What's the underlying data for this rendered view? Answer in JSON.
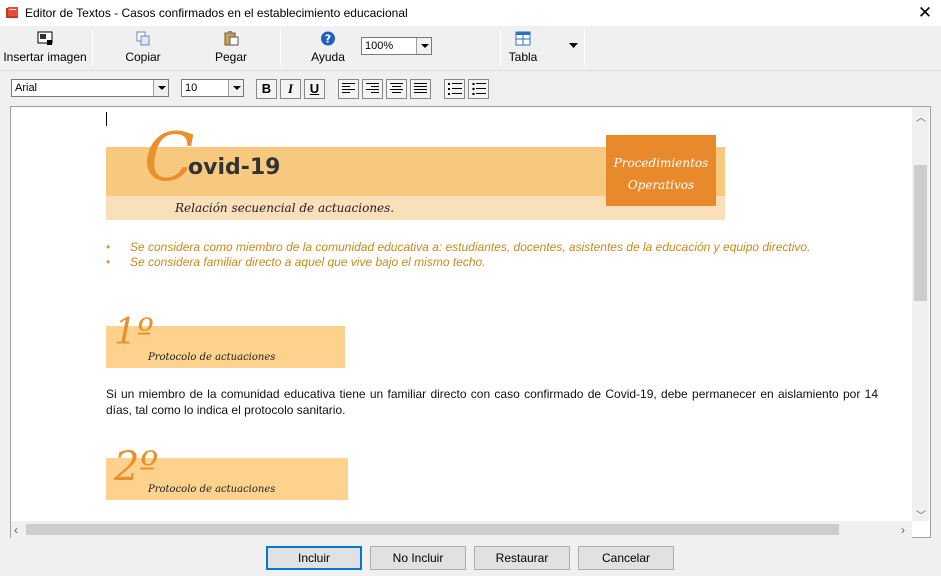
{
  "window": {
    "title": "Editor de Textos - Casos confirmados en el establecimiento educacional"
  },
  "toolbar": {
    "insert_image": "Insertar imagen",
    "copy": "Copiar",
    "paste": "Pegar",
    "help": "Ayuda",
    "zoom": "100%",
    "table": "Tabla"
  },
  "format": {
    "font": "Arial",
    "size": "10",
    "bold": "B",
    "italic": "I",
    "underline": "U"
  },
  "document": {
    "banner": {
      "big_letter": "C",
      "title": "ovid-19",
      "subtitle": "Relación secuencial de actuaciones.",
      "box_line1": "Procedimientos",
      "box_line2": "Operativos"
    },
    "bullets": [
      "Se considera como miembro de la comunidad educativa a: estudiantes, docentes, asistentes de la educación y equipo directivo.",
      "Se considera familiar directo a aquel que vive bajo el mismo techo."
    ],
    "step1": {
      "num": "1º",
      "label": "Protocolo de actuaciones"
    },
    "paragraph1": "Si un miembro de la comunidad educativa tiene un familiar directo con caso confirmado de Covid-19, debe permanecer en aislamiento por 14 días, tal como lo indica el protocolo sanitario.",
    "step2": {
      "num": "2º",
      "label": "Protocolo de actuaciones"
    }
  },
  "buttons": {
    "include": "Incluir",
    "no_include": "No Incluir",
    "restore": "Restaurar",
    "cancel": "Cancelar"
  },
  "colors": {
    "accent_orange": "#e8892c",
    "banner": "#f7c97f",
    "focus_blue": "#0078d7"
  }
}
